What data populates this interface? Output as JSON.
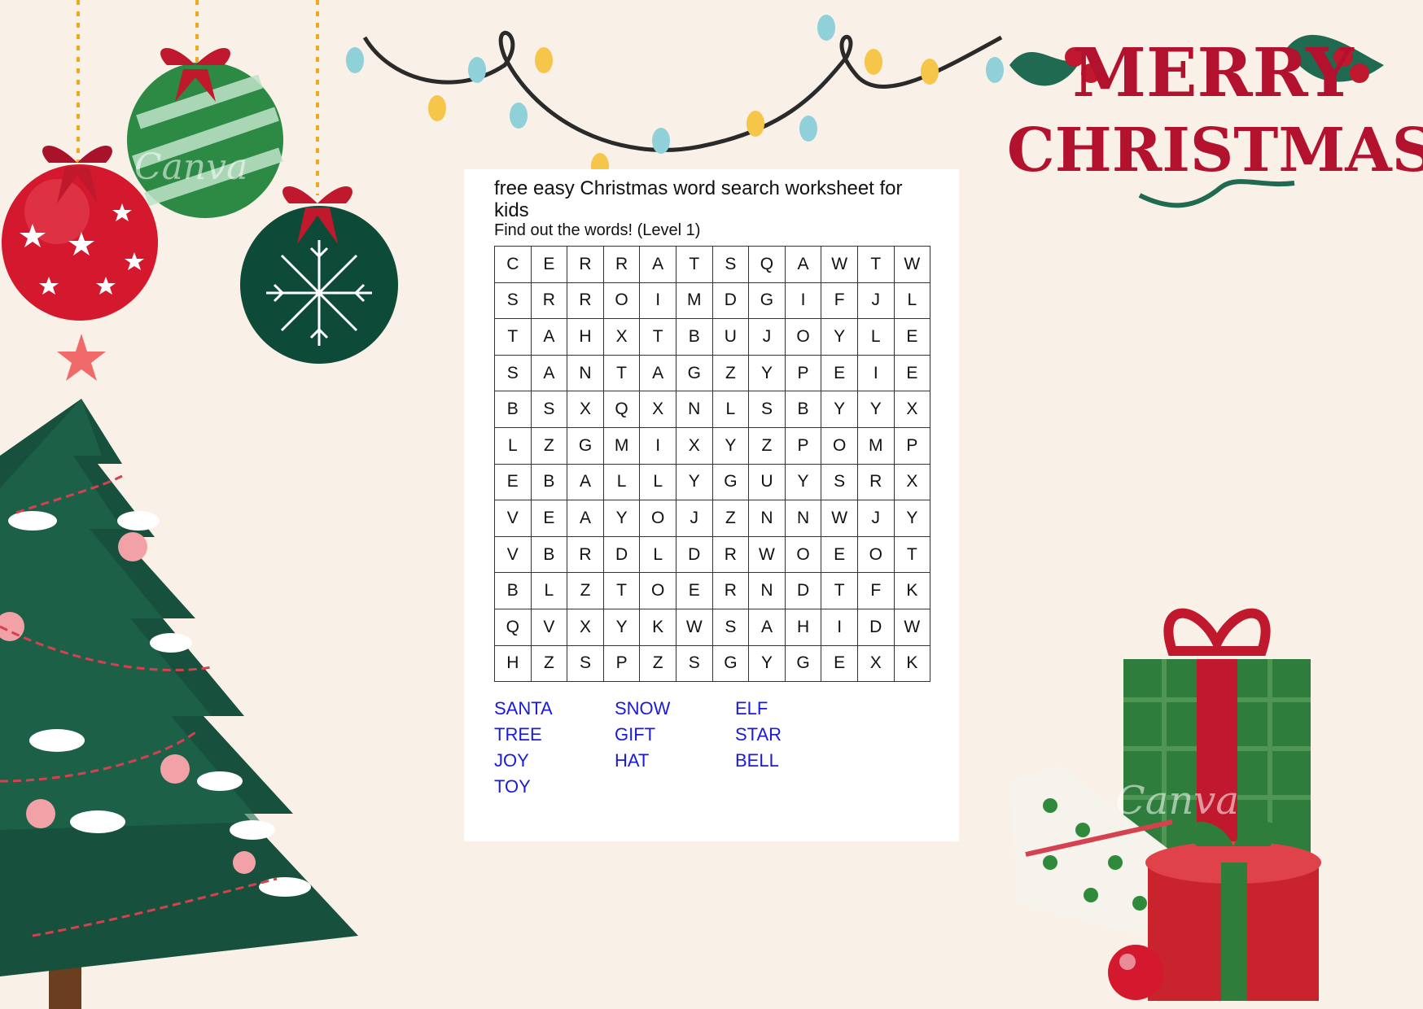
{
  "worksheet": {
    "title": "free easy Christmas word search worksheet for kids",
    "subtitle": "Find out the words! (Level 1)",
    "grid": [
      [
        "C",
        "E",
        "R",
        "R",
        "A",
        "T",
        "S",
        "Q",
        "A",
        "W",
        "T",
        "W"
      ],
      [
        "S",
        "R",
        "R",
        "O",
        "I",
        "M",
        "D",
        "G",
        "I",
        "F",
        "J",
        "L"
      ],
      [
        "T",
        "A",
        "H",
        "X",
        "T",
        "B",
        "U",
        "J",
        "O",
        "Y",
        "L",
        "E"
      ],
      [
        "S",
        "A",
        "N",
        "T",
        "A",
        "G",
        "Z",
        "Y",
        "P",
        "E",
        "I",
        "E"
      ],
      [
        "B",
        "S",
        "X",
        "Q",
        "X",
        "N",
        "L",
        "S",
        "B",
        "Y",
        "Y",
        "X"
      ],
      [
        "L",
        "Z",
        "G",
        "M",
        "I",
        "X",
        "Y",
        "Z",
        "P",
        "O",
        "M",
        "P"
      ],
      [
        "E",
        "B",
        "A",
        "L",
        "L",
        "Y",
        "G",
        "U",
        "Y",
        "S",
        "R",
        "X"
      ],
      [
        "V",
        "E",
        "A",
        "Y",
        "O",
        "J",
        "Z",
        "N",
        "N",
        "W",
        "J",
        "Y"
      ],
      [
        "V",
        "B",
        "R",
        "D",
        "L",
        "D",
        "R",
        "W",
        "O",
        "E",
        "O",
        "T"
      ],
      [
        "B",
        "L",
        "Z",
        "T",
        "O",
        "E",
        "R",
        "N",
        "D",
        "T",
        "F",
        "K"
      ],
      [
        "Q",
        "V",
        "X",
        "Y",
        "K",
        "W",
        "S",
        "A",
        "H",
        "I",
        "D",
        "W"
      ],
      [
        "H",
        "Z",
        "S",
        "P",
        "Z",
        "S",
        "G",
        "Y",
        "G",
        "E",
        "X",
        "K"
      ]
    ],
    "words": [
      "SANTA",
      "SNOW",
      "ELF",
      "TREE",
      "GIFT",
      "STAR",
      "JOY",
      "HAT",
      "BELL",
      "TOY"
    ],
    "word_color": "#1a1adb"
  },
  "decor": {
    "greeting_line1": "MERRY",
    "greeting_line2": "CHRISTMAS",
    "greeting_color": "#b3122e",
    "watermark": "Canva",
    "icons": [
      "ornament-icon",
      "christmas-tree-icon",
      "string-lights-icon",
      "holly-icon",
      "gift-boxes-icon"
    ]
  }
}
